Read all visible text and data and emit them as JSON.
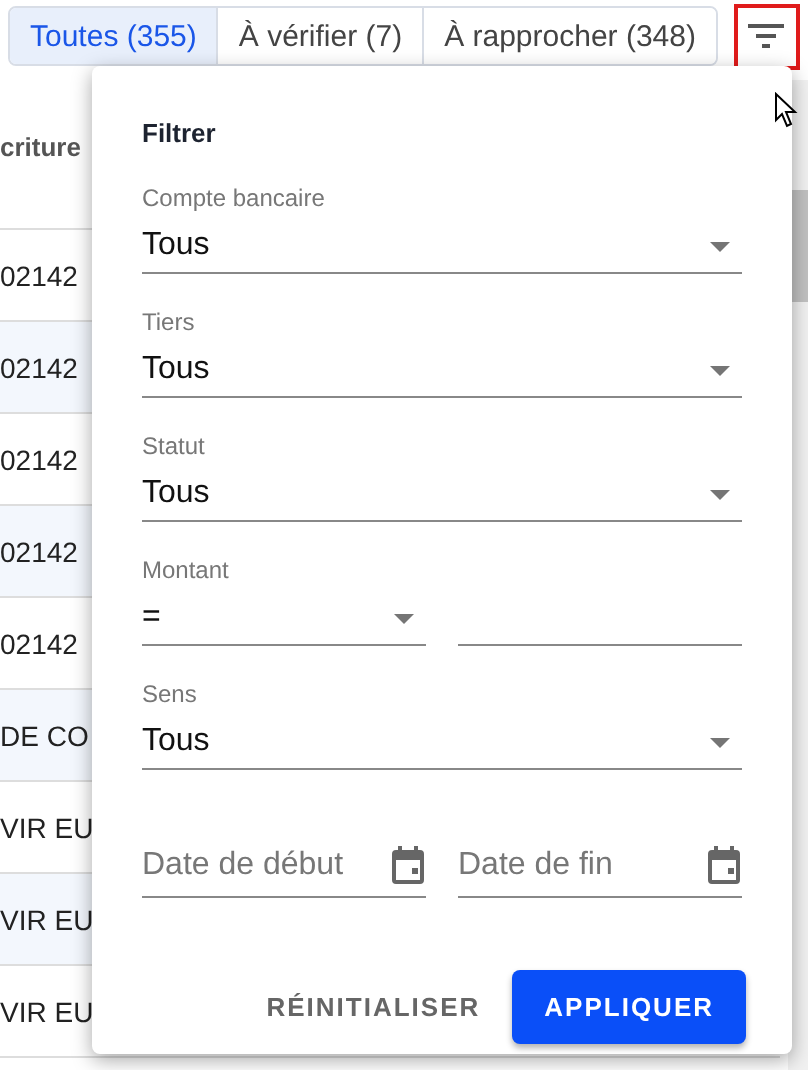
{
  "tabs": [
    {
      "label": "Toutes (355)",
      "selected": true
    },
    {
      "label": "À vérifier (7)",
      "selected": false
    },
    {
      "label": "À rapprocher (348)",
      "selected": false
    }
  ],
  "filter_button": {
    "highlighted": true
  },
  "table": {
    "columns": [
      "criture"
    ],
    "rows": [
      {
        "column_1": "02142"
      },
      {
        "column_1": "02142"
      },
      {
        "column_1": "02142"
      },
      {
        "column_1": "02142"
      },
      {
        "column_1": "02142"
      },
      {
        "column_1": "DE CO"
      },
      {
        "column_1": "VIR EU"
      },
      {
        "column_1": "VIR EU"
      },
      {
        "column_1": "VIR EU"
      }
    ]
  },
  "filter_panel": {
    "title": "Filtrer",
    "fields": [
      {
        "kind": "select",
        "label": "Compte bancaire",
        "value": "Tous"
      },
      {
        "kind": "select",
        "label": "Tiers",
        "value": "Tous"
      },
      {
        "kind": "select",
        "label": "Statut",
        "value": "Tous"
      },
      {
        "kind": "amount",
        "label": "Montant",
        "value": "="
      },
      {
        "kind": "select",
        "label": "Sens",
        "value": "Tous"
      },
      {
        "kind": "dates",
        "placeholders": [
          "Date de début",
          "Date de fin"
        ]
      }
    ],
    "buttons": [
      {
        "kind": "text",
        "label": "RÉINITIALISER"
      },
      {
        "kind": "primary",
        "label": "APPLIQUER"
      }
    ]
  }
}
